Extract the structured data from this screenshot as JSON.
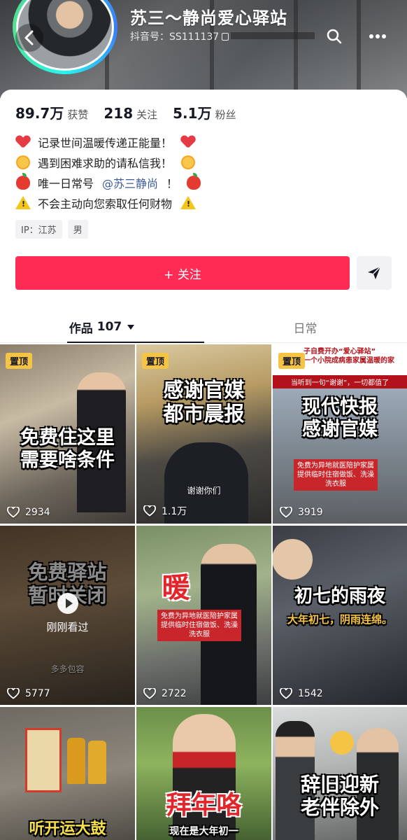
{
  "profile": {
    "nickname": "苏三～静尚爱心驿站",
    "account_id": "抖音号：SS111137"
  },
  "stats": [
    {
      "num": "89.7万",
      "label": "获赞"
    },
    {
      "num": "218",
      "label": "关注"
    },
    {
      "num": "5.1万",
      "label": "粉丝"
    }
  ],
  "bio": {
    "line1": "记录世间温暖传递正能量！",
    "line2": "遇到困难求助的请私信我！",
    "line3_pre": "唯一日常号",
    "line3_mention": "@苏三静尚",
    "line3_post": "！",
    "line4": "不会主动向您索取任何财物"
  },
  "tags": [
    "IP：江苏",
    "男"
  ],
  "actions": {
    "follow": "+ 关注"
  },
  "tabs": {
    "works_label": "作品",
    "works_count": "107",
    "daily_label": "日常"
  },
  "videos": [
    {
      "pinned": "置顶",
      "caption": "免费住这里\n需要啥条件",
      "likes": "2934"
    },
    {
      "pinned": "置顶",
      "caption": "感谢官媒\n都市晨报",
      "sub": "谢谢你们",
      "likes": "1.1万"
    },
    {
      "pinned": "置顶",
      "top_text": "子自费开办“爱心驿站”\n一个小院成病患家属温暖的家",
      "top_text2": "当听到一句“谢谢”，一切都值了",
      "caption": "现代快报\n感谢官媒",
      "banner": "免费为异地就医陪护家属\n提供临时住宿做饭、洗澡\n洗衣服",
      "likes": "3919"
    },
    {
      "caption": "免费驿站\n暂时关闭",
      "watched": "刚刚看过",
      "sub": "多多包容",
      "likes": "5777"
    },
    {
      "caption": "暖",
      "banner": "免费为异地就医陪护家属\n提供临时住宿做饭、洗澡\n洗衣服",
      "likes": "2722"
    },
    {
      "caption": "初七的雨夜",
      "sub2": "大年初七，阴雨连绵。",
      "likes": "1542"
    },
    {
      "caption": "听开运大鼓",
      "likes": ""
    },
    {
      "caption": "拜年咯",
      "sub": "现在是大年初一",
      "likes": ""
    },
    {
      "caption": "辞旧迎新\n老伴除外",
      "likes": ""
    }
  ],
  "colors": {
    "follow": "#fe2c55",
    "pin": "#f6c445",
    "mention": "#3d5a9e"
  }
}
